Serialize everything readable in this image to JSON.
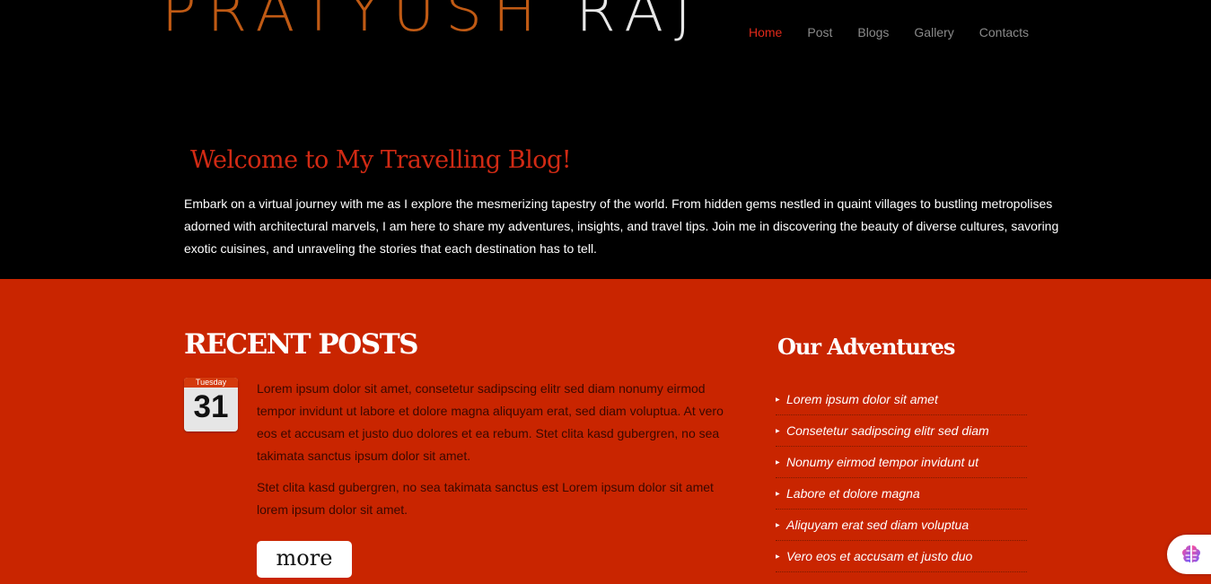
{
  "logo": {
    "first": "PRATYUSH",
    "last": "RAJ"
  },
  "nav": {
    "items": [
      {
        "label": "Home",
        "active": true
      },
      {
        "label": "Post",
        "active": false
      },
      {
        "label": "Blogs",
        "active": false
      },
      {
        "label": "Gallery",
        "active": false
      },
      {
        "label": "Contacts",
        "active": false
      }
    ]
  },
  "welcome": {
    "title": "Welcome to My Travelling Blog!",
    "text": "Embark on a virtual journey with me as I explore the mesmerizing tapestry of the world. From hidden gems nestled in quaint villages to bustling metropolises adorned with architectural marvels, I am here to share my adventures, insights, and travel tips. Join me in discovering the beauty of diverse cultures, savoring exotic cuisines, and unraveling the stories that each destination has to tell."
  },
  "recent": {
    "title": "RECENT POSTS",
    "date": {
      "weekday": "Tuesday",
      "day": "31"
    },
    "paragraphs": [
      "Lorem ipsum dolor sit amet, consetetur sadipscing elitr sed diam nonumy eirmod tempor invidunt ut labore et dolore magna aliquyam erat, sed diam voluptua. At vero eos et accusam et justo duo dolores et ea rebum. Stet clita kasd gubergren, no sea takimata sanctus ipsum dolor sit amet.",
      "Stet clita kasd gubergren, no sea takimata sanctus est Lorem ipsum dolor sit amet lorem ipsum dolor sit amet."
    ],
    "more_label": "more"
  },
  "adventures": {
    "title": "Our Adventures",
    "items": [
      "Lorem ipsum dolor sit amet",
      "Consetetur sadipscing elitr sed diam",
      "Nonumy eirmod tempor invidunt ut",
      "Labore et dolore magna",
      "Aliquyam erat sed diam voluptua",
      "Vero eos et accusam et justo duo"
    ]
  },
  "widget": {
    "icon": "brain-icon"
  },
  "colors": {
    "accent": "#d12a14",
    "content_bg": "#c92500",
    "header_bg": "#000000",
    "logo_orange": "#c05a14"
  }
}
